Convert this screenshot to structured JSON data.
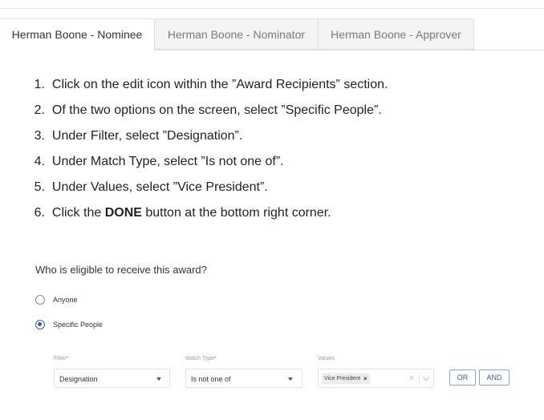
{
  "tabs": [
    {
      "label": "Herman Boone - Nominee",
      "active": true
    },
    {
      "label": "Herman Boone - Nominator",
      "active": false
    },
    {
      "label": "Herman Boone - Approver",
      "active": false
    }
  ],
  "steps": [
    {
      "num": "1.",
      "text": "Click on the edit icon within the ”Award Recipients” section."
    },
    {
      "num": "2.",
      "text": "Of the two options on the screen, select ”Specific People”."
    },
    {
      "num": "3.",
      "text": "Under Filter, select ”Designation”."
    },
    {
      "num": "4.",
      "text": "Under Match Type, select ”Is not one of”."
    },
    {
      "num": "5.",
      "text": "Under Values, select ”Vice President”."
    },
    {
      "num": "6.",
      "text_before": "Click the ",
      "text_bold": "DONE",
      "text_after": " button at the bottom right corner."
    }
  ],
  "eligibility": {
    "question": "Who is eligible to receive this award?",
    "options": [
      {
        "label": "Anyone",
        "selected": false
      },
      {
        "label": "Specific People",
        "selected": true
      }
    ],
    "filter": {
      "label": "Filter*",
      "value": "Designation"
    },
    "match_type": {
      "label": "Match Type*",
      "value": "Is not one of"
    },
    "values": {
      "label": "Values",
      "chip": "Vice President",
      "chip_remove": "×",
      "clear": "×"
    },
    "or_label": "OR",
    "and_label": "AND"
  },
  "colors": {
    "accent": "#3a5ba8",
    "tab_inactive_bg": "#f4f4f4",
    "border": "#dedede"
  },
  "icons": [
    "caret-down-icon",
    "close-icon",
    "chevron-down-icon",
    "radio-checked-icon",
    "radio-unchecked-icon"
  ]
}
